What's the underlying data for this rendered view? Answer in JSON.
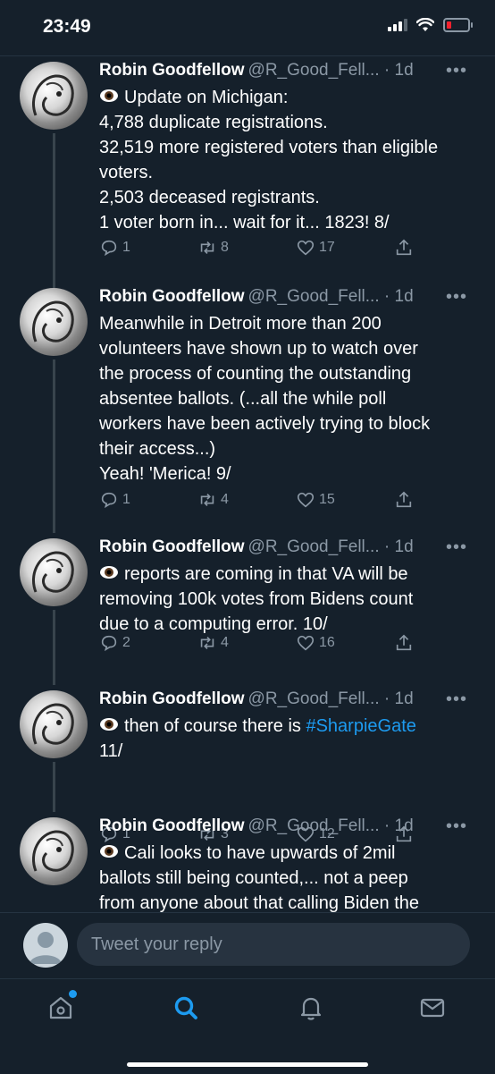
{
  "status_bar": {
    "time": "23:49"
  },
  "colors": {
    "background": "#15202b",
    "accent": "#1d9bf0",
    "secondary_text": "#8b98a5",
    "battery_low": "#f4212e"
  },
  "tweets": [
    {
      "name": "Robin Goodfellow",
      "handle": "@R_Good_Fell...",
      "time": "· 1d",
      "more": "•••",
      "lines": [
        "Update on Michigan:",
        "4,788 duplicate registrations.",
        "32,519 more registered voters than eligible",
        "voters.",
        "2,503 deceased registrants.",
        "1 voter born in... wait for it... 1823! 8/"
      ],
      "replies": "1",
      "retweets": "8",
      "likes": "17"
    },
    {
      "name": "Robin Goodfellow",
      "handle": "@R_Good_Fell...",
      "time": "· 1d",
      "more": "•••",
      "lines": [
        "Meanwhile in Detroit more than 200",
        "volunteers have shown up to watch over",
        "the process of counting the outstanding",
        "absentee ballots. (...all the while poll",
        "workers have been actively trying to block",
        "their access...)",
        "Yeah! 'Merica! 9/"
      ],
      "replies": "1",
      "retweets": "4",
      "likes": "15"
    },
    {
      "name": "Robin Goodfellow",
      "handle": "@R_Good_Fell...",
      "time": "· 1d",
      "more": "•••",
      "lines": [
        "reports are coming in that VA will be",
        "removing 100k votes from Bidens count",
        "due to a computing error. 10/"
      ],
      "replies": "2",
      "retweets": "4",
      "likes": "16"
    },
    {
      "name": "Robin Goodfellow",
      "handle": "@R_Good_Fell...",
      "time": "· 1d",
      "more": "•••",
      "text_prefix": "then of course there is ",
      "hashtag": "#SharpieGate",
      "line2": "11/",
      "replies": "1",
      "retweets": "3",
      "likes": "12"
    },
    {
      "name": "Robin Goodfellow",
      "handle": "@R_Good_Fell...",
      "time": "· 1d",
      "more": "•••",
      "lines": [
        "Cali looks to have upwards of 2mil",
        "ballots still being counted,... not a peep",
        "from anyone about that calling Biden the"
      ]
    }
  ],
  "reply_box": {
    "placeholder": "Tweet your reply"
  },
  "tab_bar": {
    "items": [
      "home-icon",
      "search-icon",
      "notifications-icon",
      "messages-icon"
    ]
  }
}
